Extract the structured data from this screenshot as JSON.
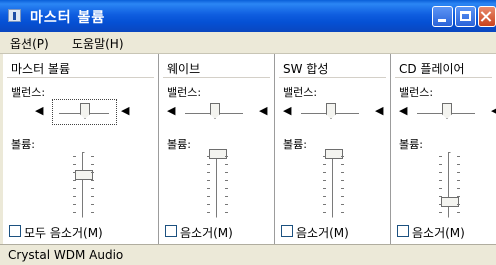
{
  "window": {
    "title": "마스터 볼륨"
  },
  "menu": {
    "options": "옵션(P)",
    "help": "도움말(H)"
  },
  "columns": [
    {
      "title": "마스터 볼륨",
      "balance_label": "밸런스:",
      "volume_label": "볼륨:",
      "mute_label": "모두 음소거(M)",
      "muted": false,
      "balance": 0.5,
      "volume": 0.6
    },
    {
      "title": "웨이브",
      "balance_label": "밸런스:",
      "volume_label": "볼륨:",
      "mute_label": "음소거(M)",
      "muted": false,
      "balance": 0.5,
      "volume": 1.0
    },
    {
      "title": "SW 합성",
      "balance_label": "밸런스:",
      "volume_label": "볼륨:",
      "mute_label": "음소거(M)",
      "muted": false,
      "balance": 0.5,
      "volume": 1.0
    },
    {
      "title": "CD 플레이어",
      "balance_label": "밸런스:",
      "volume_label": "볼륨:",
      "mute_label": "음소거(M)",
      "muted": false,
      "balance": 0.5,
      "volume": 0.2
    }
  ],
  "status": {
    "device": "Crystal WDM Audio"
  },
  "icons": {
    "left_speaker": "speaker-left-icon",
    "right_speaker": "speaker-right-icon"
  }
}
